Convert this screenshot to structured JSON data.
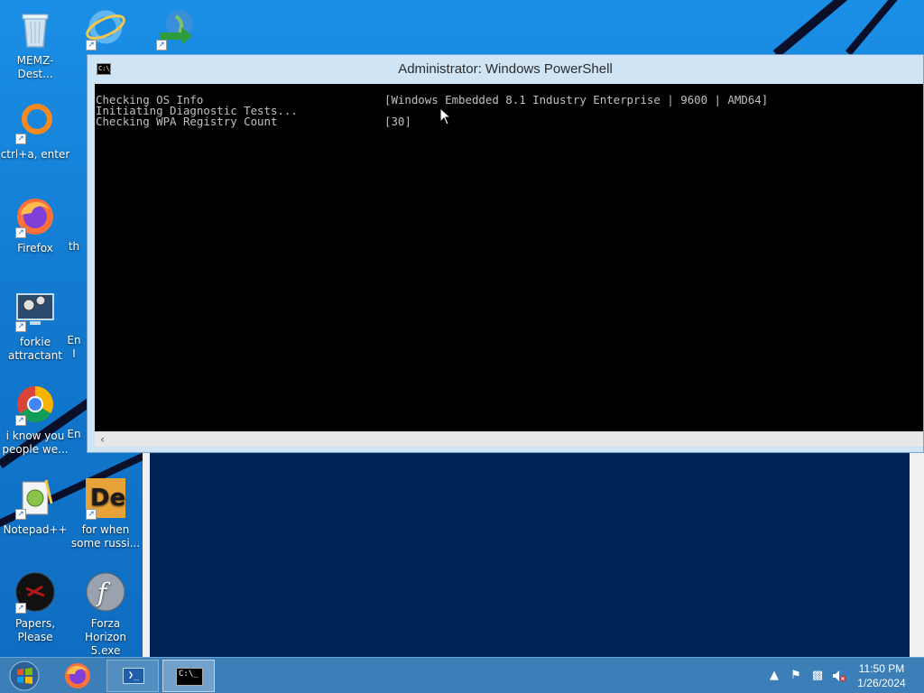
{
  "window": {
    "title": "Administrator: Windows PowerShell",
    "icon_label": "C:\\_"
  },
  "console": {
    "lines": [
      {
        "label": "Checking OS Info",
        "value": "[Windows Embedded 8.1 Industry Enterprise | 9600 | AMD64]"
      },
      {
        "label": "Initiating Diagnostic Tests...",
        "value": ""
      },
      {
        "label": "Checking WPA Registry Count",
        "value": "[30]"
      }
    ]
  },
  "desktop_icons": [
    {
      "label": "MEMZ-Dest...",
      "icon": "recycle-bin-icon"
    },
    {
      "label": "",
      "icon": "internet-explorer-icon"
    },
    {
      "label": "",
      "icon": "download-manager-icon"
    },
    {
      "label": "ctrl+a, enter",
      "icon": "orange-ring-icon"
    },
    {
      "label": "Firefox",
      "icon": "firefox-icon"
    },
    {
      "label": "forkie attractant",
      "icon": "settings-monitor-icon"
    },
    {
      "label": "i know you people we...",
      "icon": "chrome-icon"
    },
    {
      "label": "Notepad++",
      "icon": "notepad-plus-plus-icon"
    },
    {
      "label": "for when some russi...",
      "icon": "de-app-icon"
    },
    {
      "label": "Papers, Please",
      "icon": "papers-please-icon"
    },
    {
      "label": "Forza Horizon 5.exe",
      "icon": "flash-player-icon"
    }
  ],
  "partial_labels": [
    "th",
    "En",
    "I",
    "En"
  ],
  "taskbar": {
    "clock_time": "11:50 PM",
    "clock_date": "1/26/2024",
    "powershell_icon_label": "❯_",
    "cmd_icon_label": "C:\\_"
  },
  "colors": {
    "console_bg": "#000000",
    "console_fg": "#c0c0c0",
    "titlebar": "#cfe4f5",
    "taskbar": "#3c7fb8",
    "powershell_blue": "#012456"
  }
}
